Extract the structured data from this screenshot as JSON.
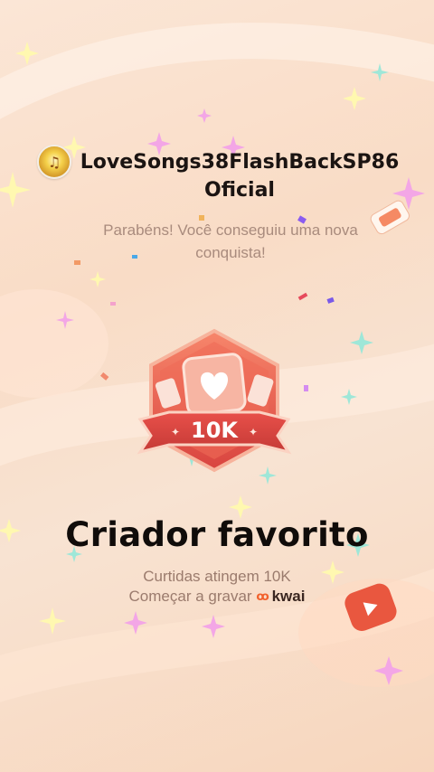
{
  "user": {
    "name": "LoveSongs38FlashBackSP86 Oficial",
    "avatar_icon": "music-note-avatar-icon"
  },
  "message": "Parabéns! Você conseguiu uma nova conquista!",
  "badge": {
    "label": "10K",
    "icon": "heart-card-icon"
  },
  "achievement": {
    "title": "Criador favorito",
    "requirement": "Curtidas atingem 10K",
    "cta": "Começar a gravar",
    "brand": "kwai"
  },
  "colors": {
    "badge_red": "#e2504a",
    "brand_orange": "#f2612c"
  }
}
